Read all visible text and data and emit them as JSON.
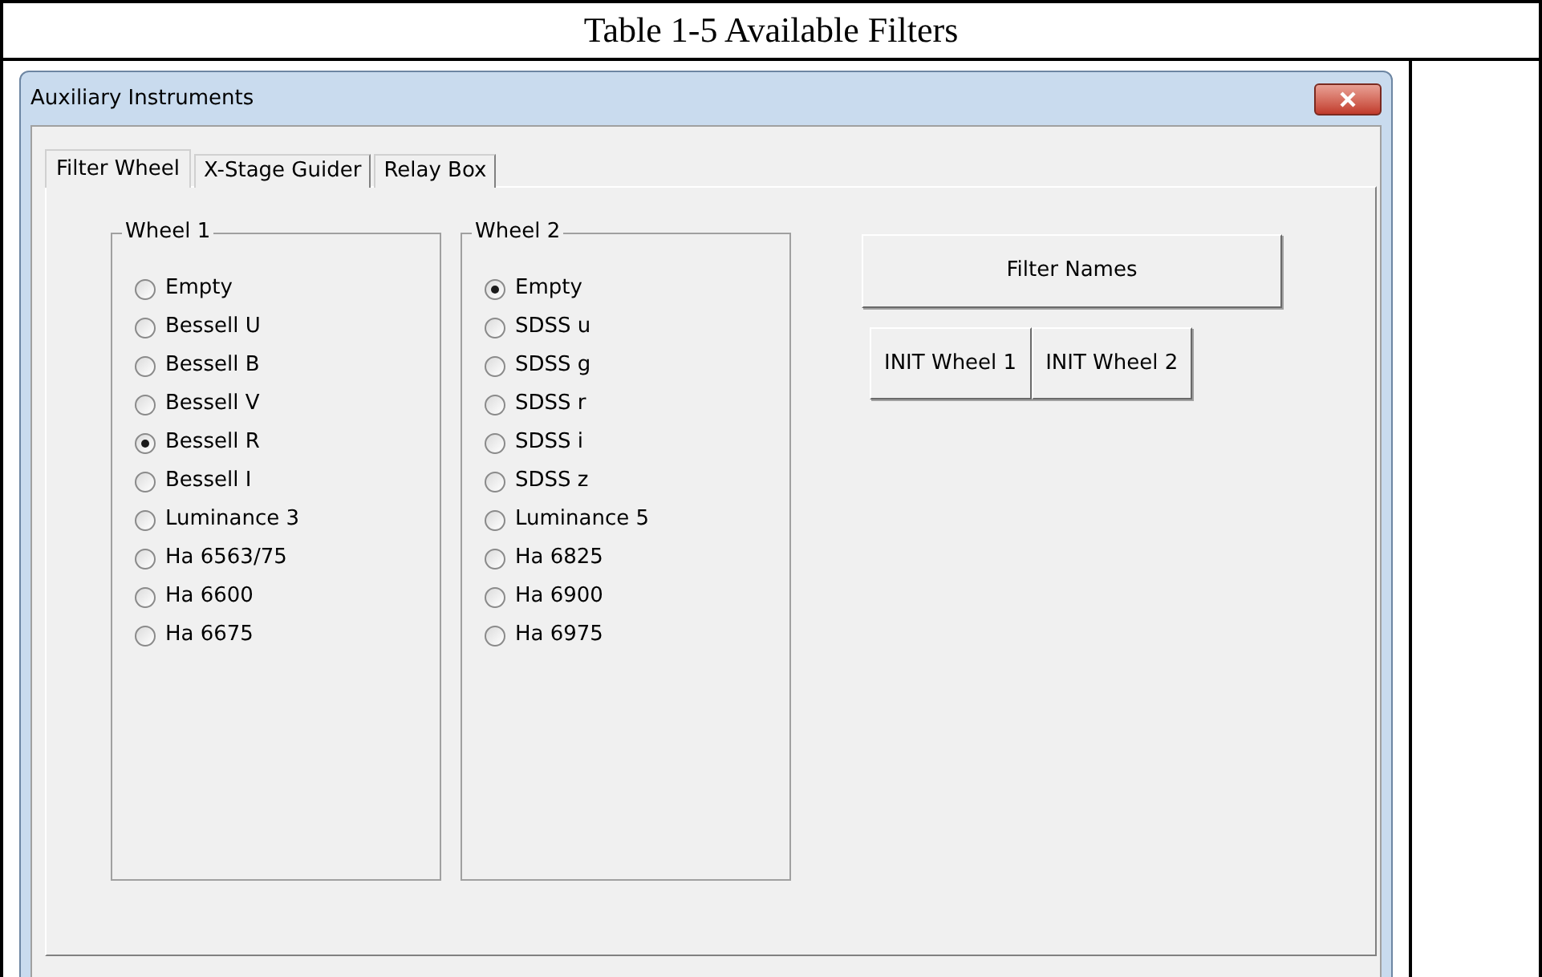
{
  "caption": "Table 1-5 Available Filters",
  "window": {
    "title": "Auxiliary Instruments"
  },
  "tabs": [
    {
      "label": "Filter Wheel",
      "selected": true
    },
    {
      "label": "X-Stage Guider",
      "selected": false
    },
    {
      "label": "Relay Box",
      "selected": false
    }
  ],
  "groups": [
    {
      "title": "Wheel 1",
      "options": [
        {
          "label": "Empty",
          "selected": false
        },
        {
          "label": "Bessell U",
          "selected": false
        },
        {
          "label": "Bessell B",
          "selected": false
        },
        {
          "label": "Bessell V",
          "selected": false
        },
        {
          "label": "Bessell R",
          "selected": true
        },
        {
          "label": "Bessell I",
          "selected": false
        },
        {
          "label": "Luminance 3",
          "selected": false
        },
        {
          "label": "Ha 6563/75",
          "selected": false
        },
        {
          "label": "Ha 6600",
          "selected": false
        },
        {
          "label": "Ha 6675",
          "selected": false
        }
      ]
    },
    {
      "title": "Wheel 2",
      "options": [
        {
          "label": "Empty",
          "selected": true
        },
        {
          "label": "SDSS u",
          "selected": false
        },
        {
          "label": "SDSS g",
          "selected": false
        },
        {
          "label": "SDSS r",
          "selected": false
        },
        {
          "label": "SDSS i",
          "selected": false
        },
        {
          "label": "SDSS z",
          "selected": false
        },
        {
          "label": "Luminance 5",
          "selected": false
        },
        {
          "label": "Ha 6825",
          "selected": false
        },
        {
          "label": "Ha 6900",
          "selected": false
        },
        {
          "label": "Ha 6975",
          "selected": false
        }
      ]
    }
  ],
  "buttons": {
    "filter_names": "Filter Names",
    "init": [
      "INIT Wheel 1",
      "INIT Wheel 2"
    ]
  }
}
